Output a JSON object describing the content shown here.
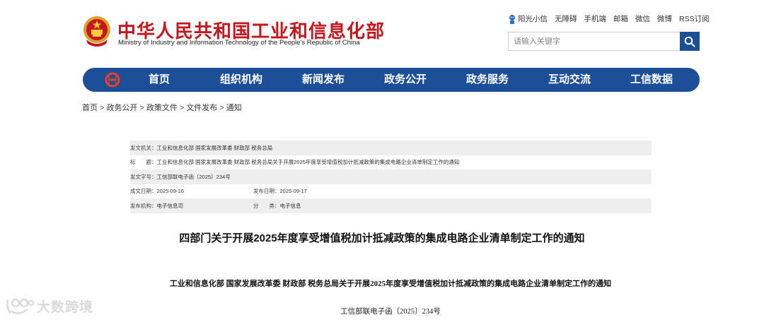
{
  "header": {
    "title_cn": "中华人民共和国工业和信息化部",
    "title_en": "Ministry of Industry and Information Technology of the People's Republic of China",
    "top_links": [
      "阳光小信",
      "无障碍",
      "手机端",
      "邮箱",
      "微信",
      "微博",
      "RSS订阅"
    ],
    "search_placeholder": "请输入关键字"
  },
  "nav": {
    "items": [
      "首页",
      "组织机构",
      "新闻发布",
      "政务公开",
      "政务服务",
      "互动交流",
      "工信数据"
    ],
    "brand_color": "#1c4f98"
  },
  "breadcrumb": [
    "首页",
    "政务公开",
    "政策文件",
    "文件发布",
    "通知"
  ],
  "meta": {
    "issuer_label": "发文机关：",
    "issuer": "工业和信息化部 国家发展改革委 财政部 税务总局",
    "title_label": "标　　题：",
    "title": "工业和信息化部 国家发展改革委 财政部 税务总局关于开展2025年度享受增值税加计抵减政策的集成电路企业清单制定工作的通知",
    "doc_no_label": "发文字号：",
    "doc_no": "工信部联电子函〔2025〕234号",
    "created_label": "成文日期：",
    "created": "2025-09-16",
    "published_label": "发布日期：",
    "published": "2025-09-17",
    "agency_label": "发布机构：",
    "agency": "电子信息司",
    "category_label": "分　　类：",
    "category": "电子信息"
  },
  "article": {
    "title": "四部门关于开展2025年度享受增值税加计抵减政策的集成电路企业清单制定工作的通知",
    "subtitle": "工业和信息化部 国家发展改革委 财政部 税务总局关于开展2025年度享受增值税加计抵减政策的集成电路企业清单制定工作的通知",
    "doc_number": "工信部联电子函〔2025〕234号"
  },
  "watermark": {
    "text": "大数跨境"
  }
}
